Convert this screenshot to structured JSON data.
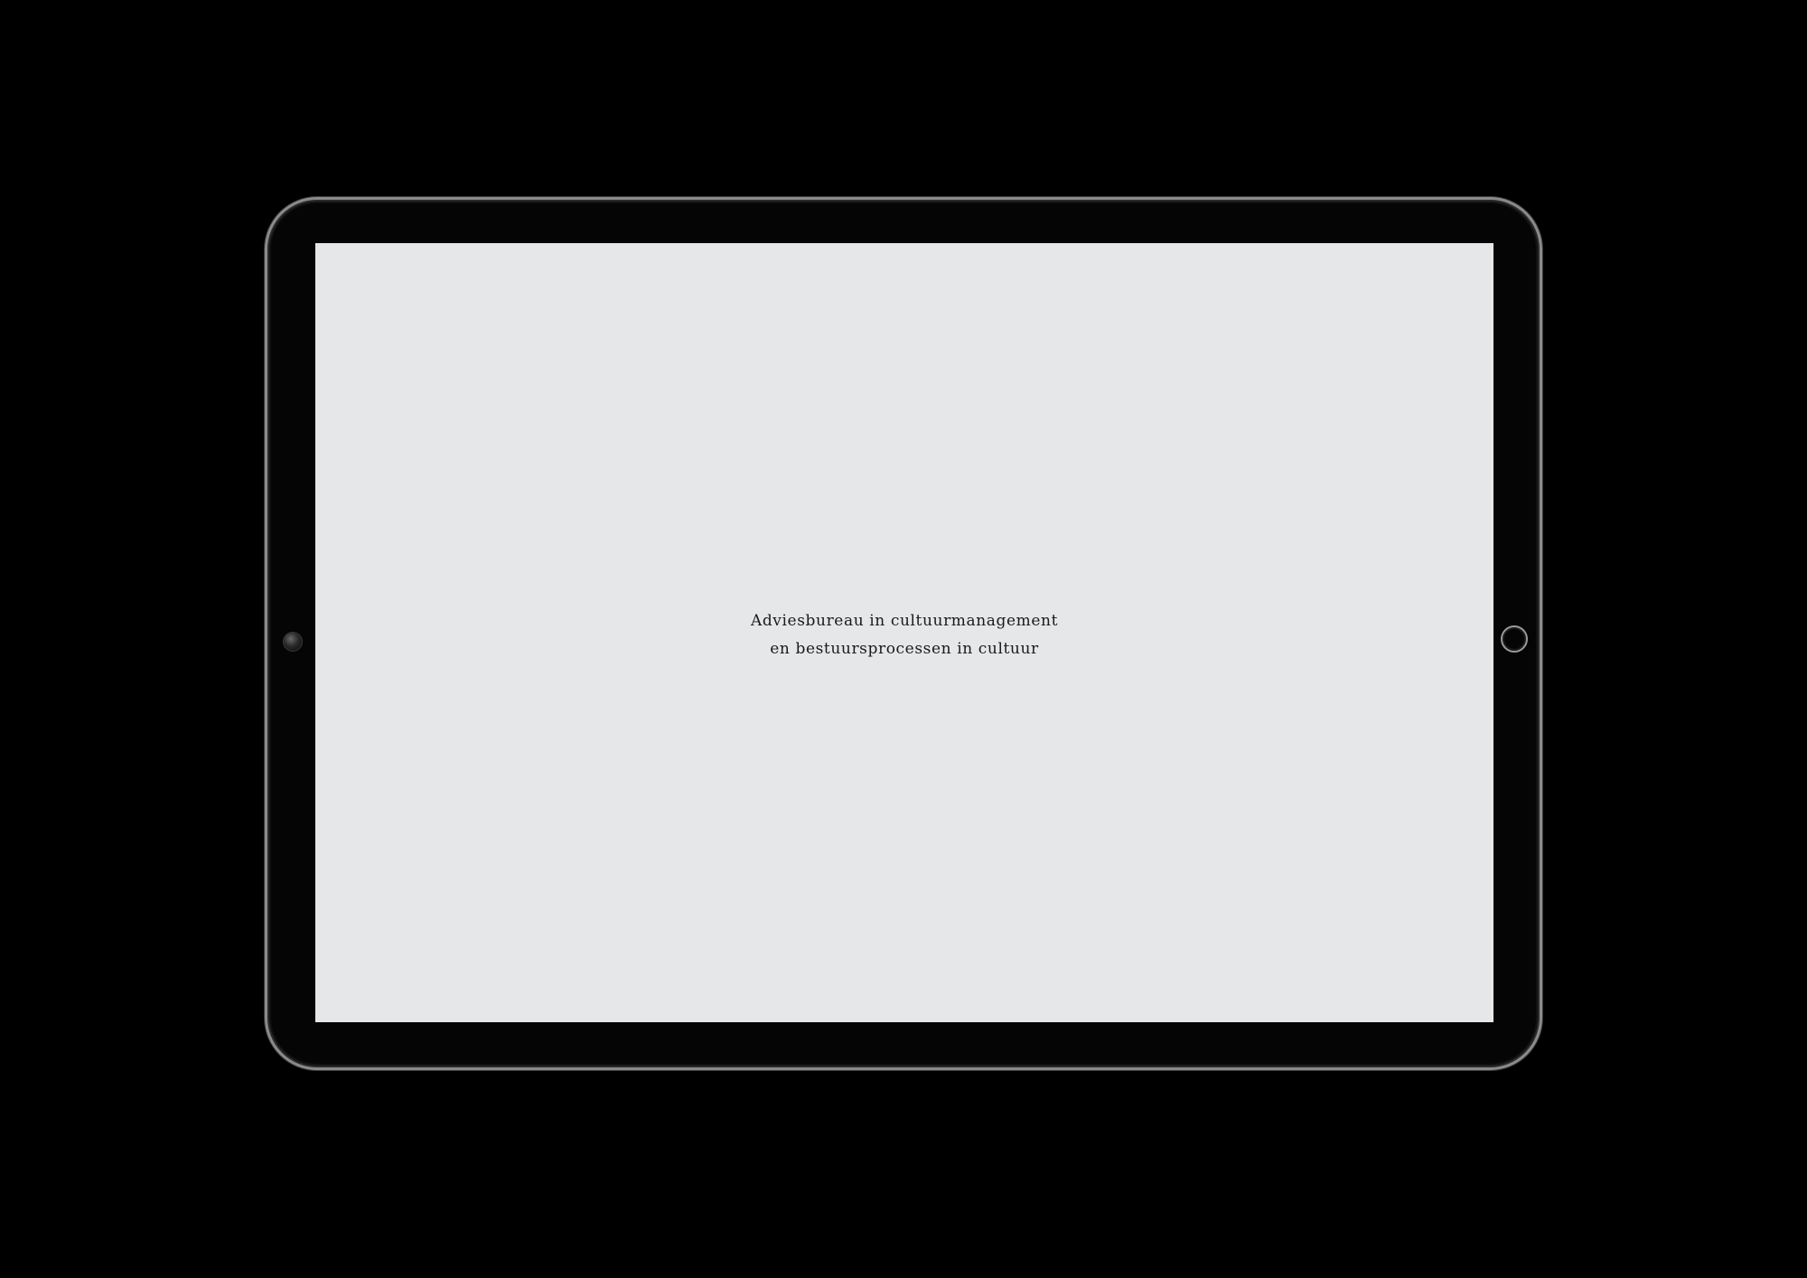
{
  "device": {
    "type": "tablet",
    "colors": {
      "background": "#000000",
      "bezel": "#050505",
      "frame": "#8a8a8a",
      "screen": "#e6e7e8",
      "text": "#1a1a1a"
    }
  },
  "screen": {
    "tagline_line1": "Adviesbureau in cultuurmanagement",
    "tagline_line2": "en bestuursprocessen in cultuur"
  },
  "icons": {
    "camera": "front-camera-icon",
    "home": "home-button-icon"
  }
}
